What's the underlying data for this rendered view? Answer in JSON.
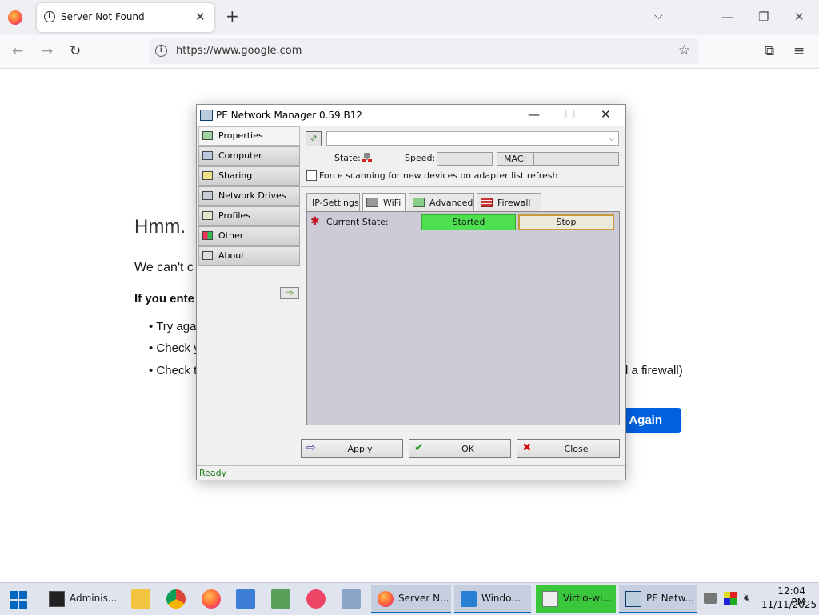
{
  "browser": {
    "tab_title": "Server Not Found",
    "url": "https://www.google.com"
  },
  "page": {
    "heading": "Hmm. ",
    "line1": "We can't c",
    "line2": "If you ente",
    "bullets": [
      "Try aga",
      "Check y",
      "Check t"
    ],
    "bullet_tail": "d a firewall)",
    "try_again": "y Again"
  },
  "dialog": {
    "title": "PE Network Manager 0.59.B12",
    "sidebar": [
      "Properties",
      "Computer",
      "Sharing",
      "Network Drives",
      "Profiles",
      "Other",
      "About"
    ],
    "state_label": "State:",
    "speed_label": "Speed:",
    "mac_label": "MAC:",
    "force_label": "Force scanning for new devices on adapter list refresh",
    "tabs": [
      "IP-Settings",
      "WiFi",
      "Advanced",
      "Firewall"
    ],
    "current_state_label": "Current State:",
    "started": "Started",
    "stop": "Stop",
    "apply": "Apply",
    "ok": "OK",
    "close": "Close",
    "status": "Ready"
  },
  "taskbar": {
    "items": [
      "Adminis...",
      "Server N...",
      "Windo...",
      "Virtio-wi...",
      "PE Netw..."
    ],
    "time": "12:04 PM",
    "date": "11/11/2025"
  }
}
